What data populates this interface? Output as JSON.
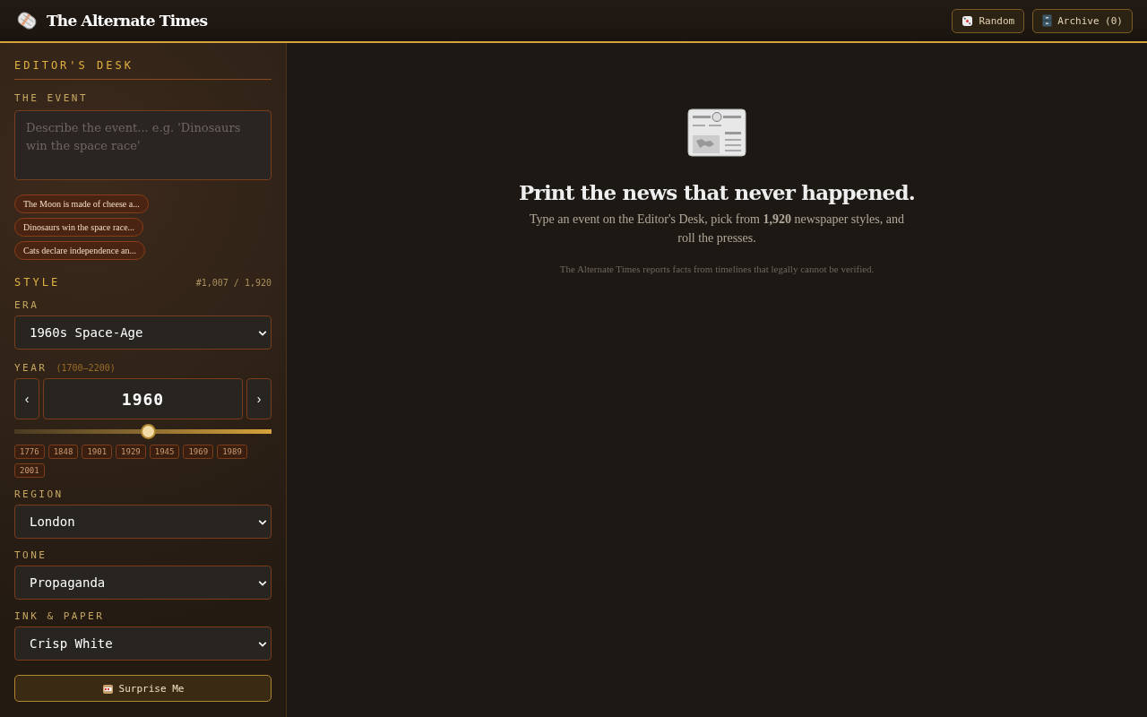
{
  "header": {
    "title": "The Alternate Times",
    "buttons": [
      {
        "kind": "random",
        "label": "Random"
      },
      {
        "kind": "archive",
        "label": "Archive (0)"
      }
    ]
  },
  "sidebar": {
    "heading": "EDITOR'S DESK",
    "event": {
      "label": "THE EVENT",
      "placeholder": "Describe the event... e.g. 'Dinosaurs win the space race'"
    },
    "suggestions": [
      "The Moon is made of cheese a...",
      "Dinosaurs win the space race...",
      "Cats declare independence an..."
    ],
    "style": {
      "label": "STYLE",
      "counter": "#1,007 / 1,920"
    },
    "era": {
      "label": "ERA",
      "value": "1960s Space-Age"
    },
    "year": {
      "label": "YEAR",
      "range": "(1700–2200)",
      "prev": "‹",
      "next": "›",
      "value": "1960",
      "level": 0.52,
      "presets": [
        "1776",
        "1848",
        "1901",
        "1929",
        "1945",
        "1969",
        "1989",
        "2001"
      ]
    },
    "region": {
      "label": "REGION",
      "value": "London"
    },
    "tone": {
      "label": "TONE",
      "value": "Propaganda"
    },
    "ink": {
      "label": "INK & PAPER",
      "value": "Crisp White"
    },
    "surprise": "Surprise Me"
  },
  "main": {
    "headline": "Print the news that never happened.",
    "lead": "Type an event on the Editor's Desk, pick from **1,920** newspaper styles, and roll the presses.",
    "note": "The Alternate Times reports facts from timelines that legally cannot be verified."
  }
}
